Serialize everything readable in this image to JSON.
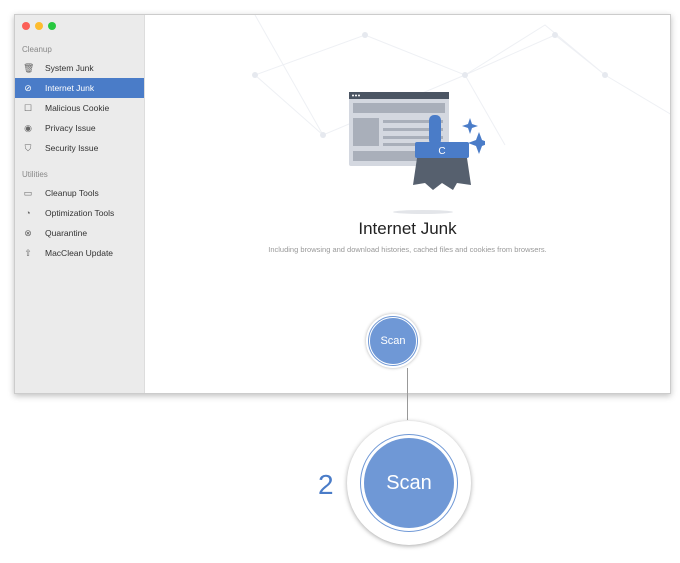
{
  "sidebar": {
    "section_cleanup": "Cleanup",
    "section_utilities": "Utilities",
    "cleanup_items": [
      {
        "label": "System Junk",
        "icon": "trash-icon"
      },
      {
        "label": "Internet Junk",
        "icon": "compass-icon",
        "active": true
      },
      {
        "label": "Malicious Cookie",
        "icon": "cookie-jar-icon"
      },
      {
        "label": "Privacy Issue",
        "icon": "eye-icon"
      },
      {
        "label": "Security Issue",
        "icon": "shield-icon"
      }
    ],
    "utility_items": [
      {
        "label": "Cleanup Tools",
        "icon": "toolbox-icon"
      },
      {
        "label": "Optimization Tools",
        "icon": "gauge-icon"
      },
      {
        "label": "Quarantine",
        "icon": "biohazard-icon"
      },
      {
        "label": "MacClean Update",
        "icon": "arrow-up-icon"
      }
    ]
  },
  "main": {
    "title": "Internet Junk",
    "subtitle": "Including browsing and download histories, cached files and cookies from browsers.",
    "scan_label": "Scan"
  },
  "callout": {
    "step": "2",
    "scan_label": "Scan"
  },
  "colors": {
    "accent": "#4a7cc8",
    "button": "#6f98d6"
  }
}
